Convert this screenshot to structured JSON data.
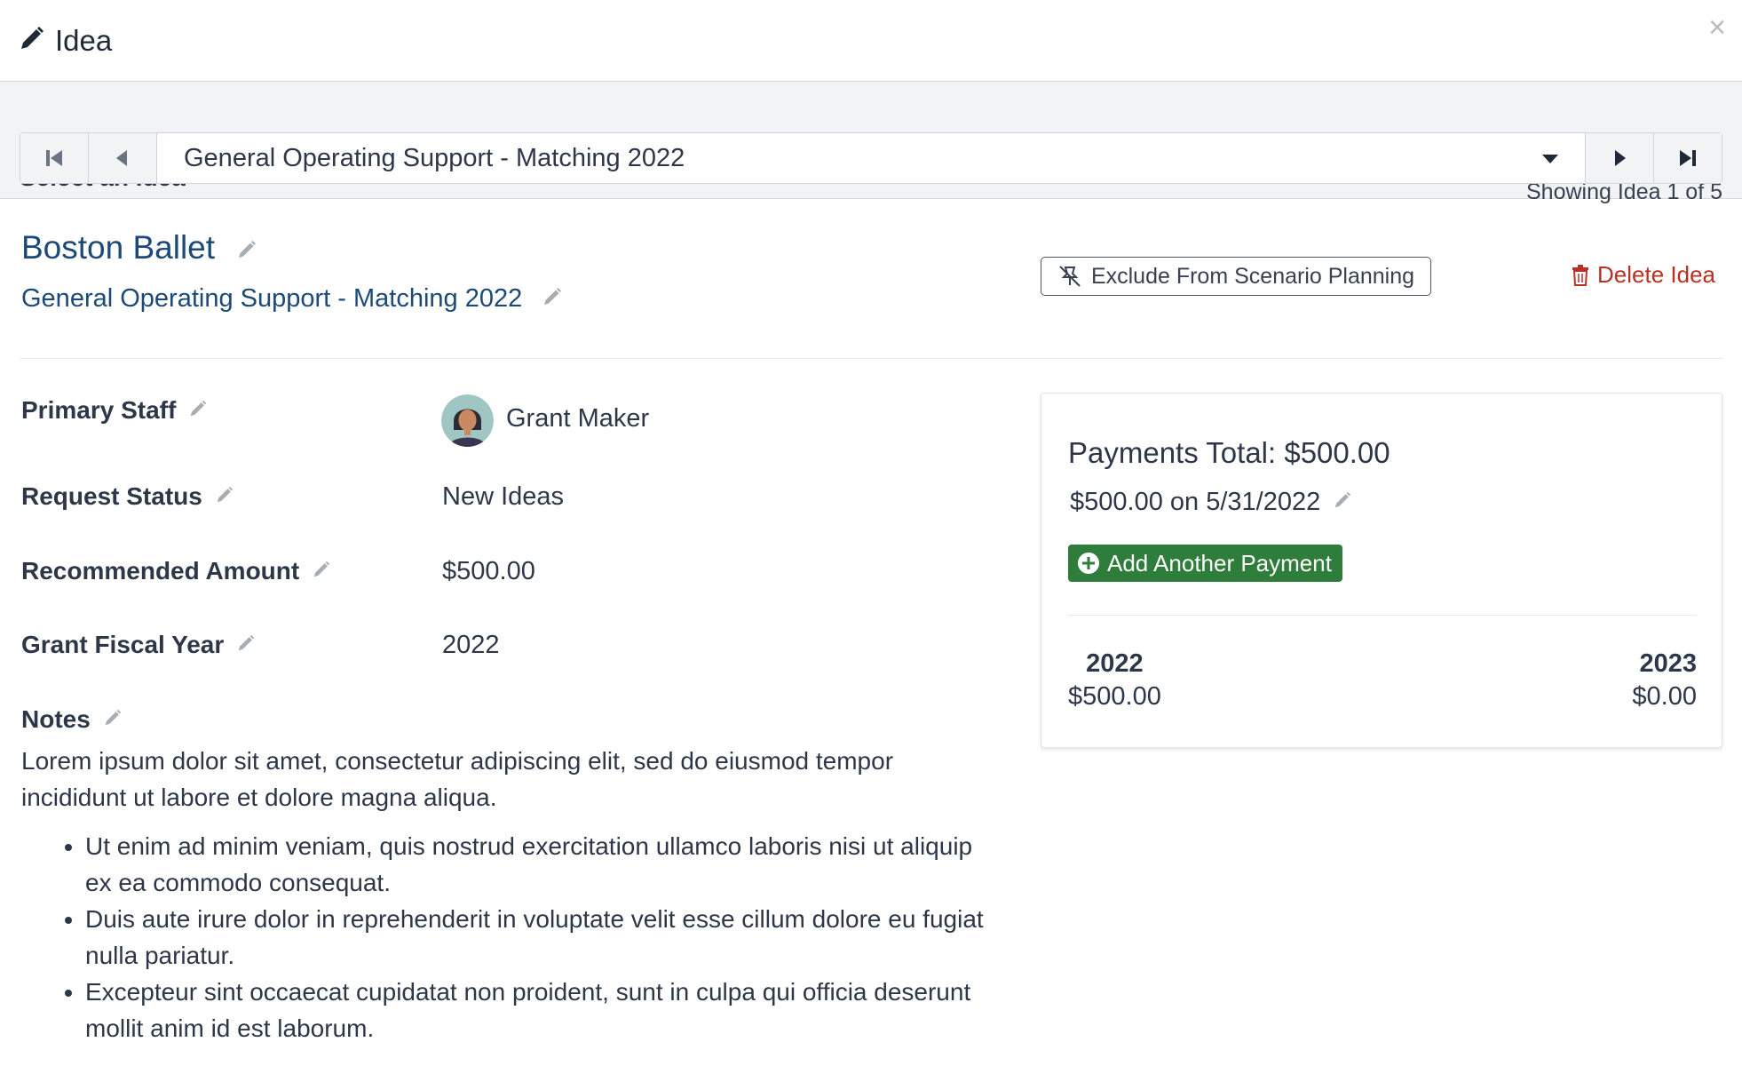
{
  "header": {
    "title": "Idea",
    "title_icon": "pencil-icon",
    "close_icon": "close-icon"
  },
  "selector": {
    "label": "Select an Idea",
    "count_text": "Showing Idea 1 of 5",
    "selected_value": "General Operating Support - Matching 2022"
  },
  "idea": {
    "organization": "Boston Ballet",
    "name": "General Operating Support - Matching 2022",
    "exclude_label": "Exclude From Scenario Planning",
    "delete_label": "Delete Idea"
  },
  "fields": {
    "primary_staff": {
      "label": "Primary Staff",
      "value": "Grant Maker"
    },
    "request_status": {
      "label": "Request Status",
      "value": "New Ideas"
    },
    "recommended_amount": {
      "label": "Recommended Amount",
      "value": "$500.00"
    },
    "grant_fiscal_year": {
      "label": "Grant Fiscal Year",
      "value": "2022"
    },
    "notes": {
      "label": "Notes",
      "text": "Lorem ipsum dolor sit amet, consectetur adipiscing elit, sed do eiusmod tempor incididunt ut labore et dolore magna aliqua.",
      "bullets": [
        "Ut enim ad minim veniam, quis nostrud exercitation ullamco laboris nisi ut aliquip ex ea commodo consequat.",
        "Duis aute irure dolor in reprehenderit in voluptate velit esse cillum dolore eu fugiat nulla pariatur.",
        "Excepteur sint occaecat cupidatat non proident, sunt in culpa qui officia deserunt mollit anim id est laborum."
      ]
    }
  },
  "payments": {
    "total": "Payments Total: $500.00",
    "line": "$500.00 on 5/31/2022",
    "add_label": "Add Another Payment",
    "years": [
      {
        "year": "2022",
        "amount": "$500.00"
      },
      {
        "year": "2023",
        "amount": "$0.00"
      }
    ]
  },
  "colors": {
    "link_blue": "#1c4a78",
    "delete_red": "#b83224",
    "add_green": "#2f7d3a"
  }
}
